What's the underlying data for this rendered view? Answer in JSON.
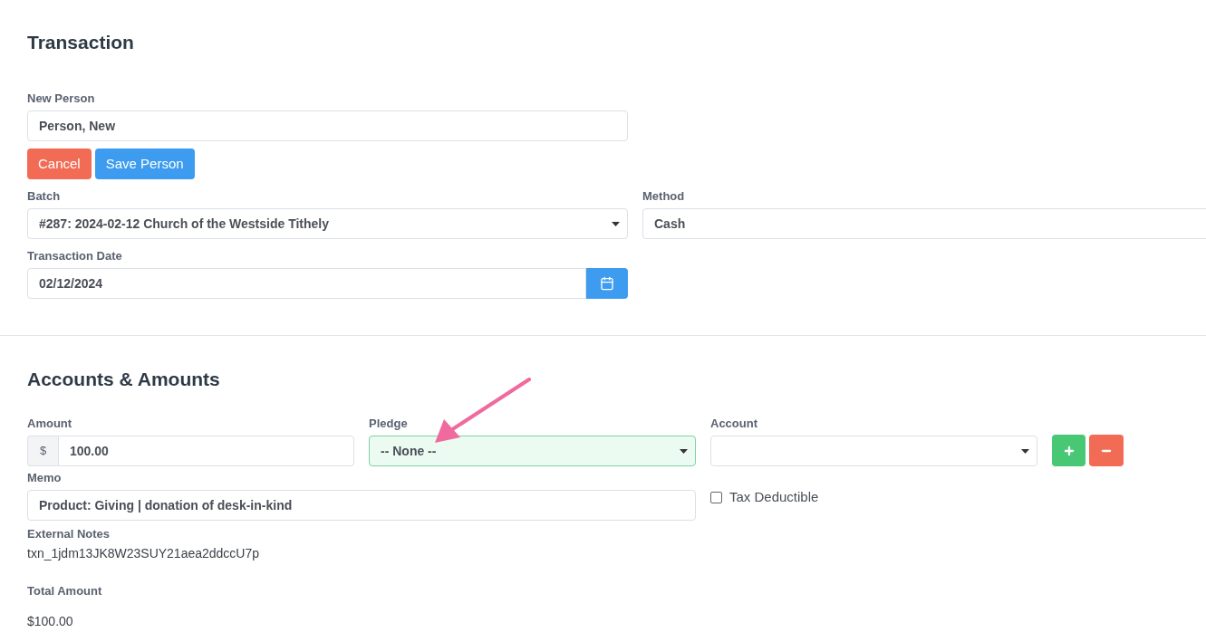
{
  "transaction": {
    "title": "Transaction",
    "new_person": {
      "label": "New Person",
      "value": "Person, New"
    },
    "buttons": [
      {
        "label": "Cancel",
        "kind": "danger"
      },
      {
        "label": "Save Person",
        "kind": "primary"
      }
    ],
    "batch": {
      "label": "Batch",
      "value": "#287: 2024-02-12 Church of the Westside Tithely"
    },
    "method": {
      "label": "Method",
      "value": "Cash"
    },
    "transaction_date": {
      "label": "Transaction Date",
      "value": "02/12/2024"
    }
  },
  "accounts": {
    "title": "Accounts & Amounts",
    "amount": {
      "label": "Amount",
      "prefix": "$",
      "value": "100.00"
    },
    "pledge": {
      "label": "Pledge",
      "value": "-- None --",
      "highlighted": true
    },
    "account": {
      "label": "Account"
    },
    "memo": {
      "label": "Memo",
      "value": "Product: Giving | donation of desk-in-kind"
    },
    "tax_deductible": {
      "label": "Tax Deductible",
      "checked": false
    },
    "external_notes": {
      "label": "External Notes",
      "value": "txn_1jdm13JK8W23SUY21aea2ddccU7p"
    },
    "total_amount": {
      "label": "Total Amount",
      "value": "$100.00"
    }
  },
  "annotation": {
    "kind": "arrow"
  }
}
